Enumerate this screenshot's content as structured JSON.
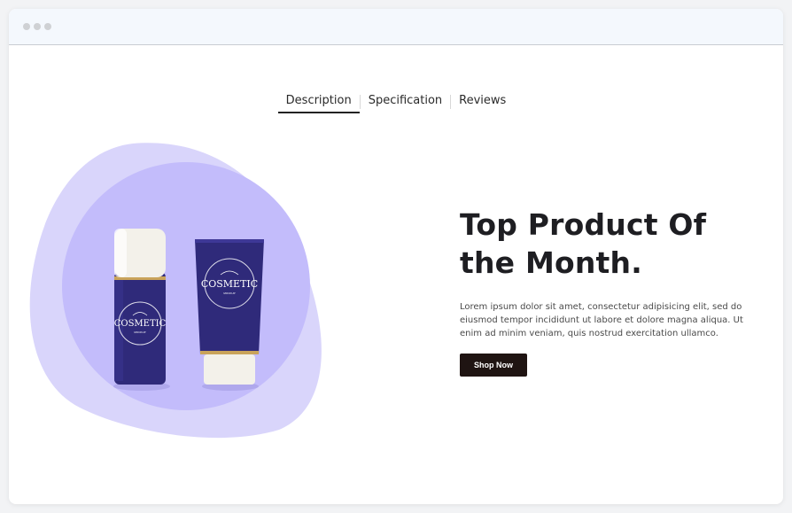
{
  "tabs": [
    {
      "label": "Description",
      "active": true
    },
    {
      "label": "Specification",
      "active": false
    },
    {
      "label": "Reviews",
      "active": false
    }
  ],
  "hero": {
    "headline_line1": "Top Product Of",
    "headline_line2": "the Month.",
    "body": "Lorem ipsum dolor sit amet, consectetur adipisicing elit, sed do eiusmod tempor incididunt ut labore et dolore magna aliqua. Ut enim ad minim veniam, quis nostrud exercitation ullamco.",
    "button_label": "Shop Now"
  },
  "product": {
    "brand_text": "COSMETIC",
    "sub_text": "MOCKUP",
    "label_tagline": "YOUR LOGO HERE"
  },
  "colors": {
    "blob_outer": "#d9d5fb",
    "blob_inner": "#c3bcfb",
    "product_navy": "#2f2a7a",
    "button_bg": "#1f1412",
    "titlebar_bg": "#f4f8fd"
  }
}
